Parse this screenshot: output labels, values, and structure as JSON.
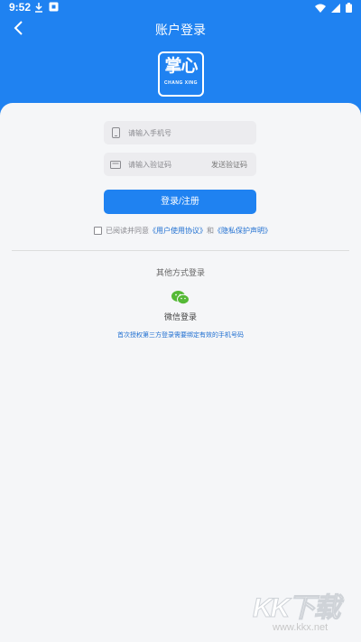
{
  "status_bar": {
    "time": "9:52",
    "left_icons": [
      "download-icon",
      "notification-icon"
    ],
    "right_icons": [
      "wifi-icon",
      "signal-icon",
      "battery-icon"
    ]
  },
  "nav": {
    "title": "账户登录",
    "back_icon": "chevron-left-icon"
  },
  "logo": {
    "main": "掌心",
    "sub": "CHANG XING"
  },
  "form": {
    "phone_placeholder": "请输入手机号",
    "code_placeholder": "请输入验证码",
    "send_code_label": "发送验证码",
    "login_button_label": "登录/注册"
  },
  "agreement": {
    "prefix": "已阅读并同意",
    "user_agreement": "《用户使用协议》",
    "conjunction": "和",
    "privacy_policy": "《隐私保护声明》"
  },
  "other_login": {
    "title": "其他方式登录",
    "wechat_label": "微信登录",
    "note": "首次授权第三方登录需要绑定有效的手机号码"
  },
  "watermark": {
    "main": "KK下载",
    "sub": "www.kkx.net"
  },
  "colors": {
    "primary": "#1f82f1",
    "background": "#f5f6f8",
    "link": "#1f6fd1",
    "wechat": "#55b936"
  }
}
